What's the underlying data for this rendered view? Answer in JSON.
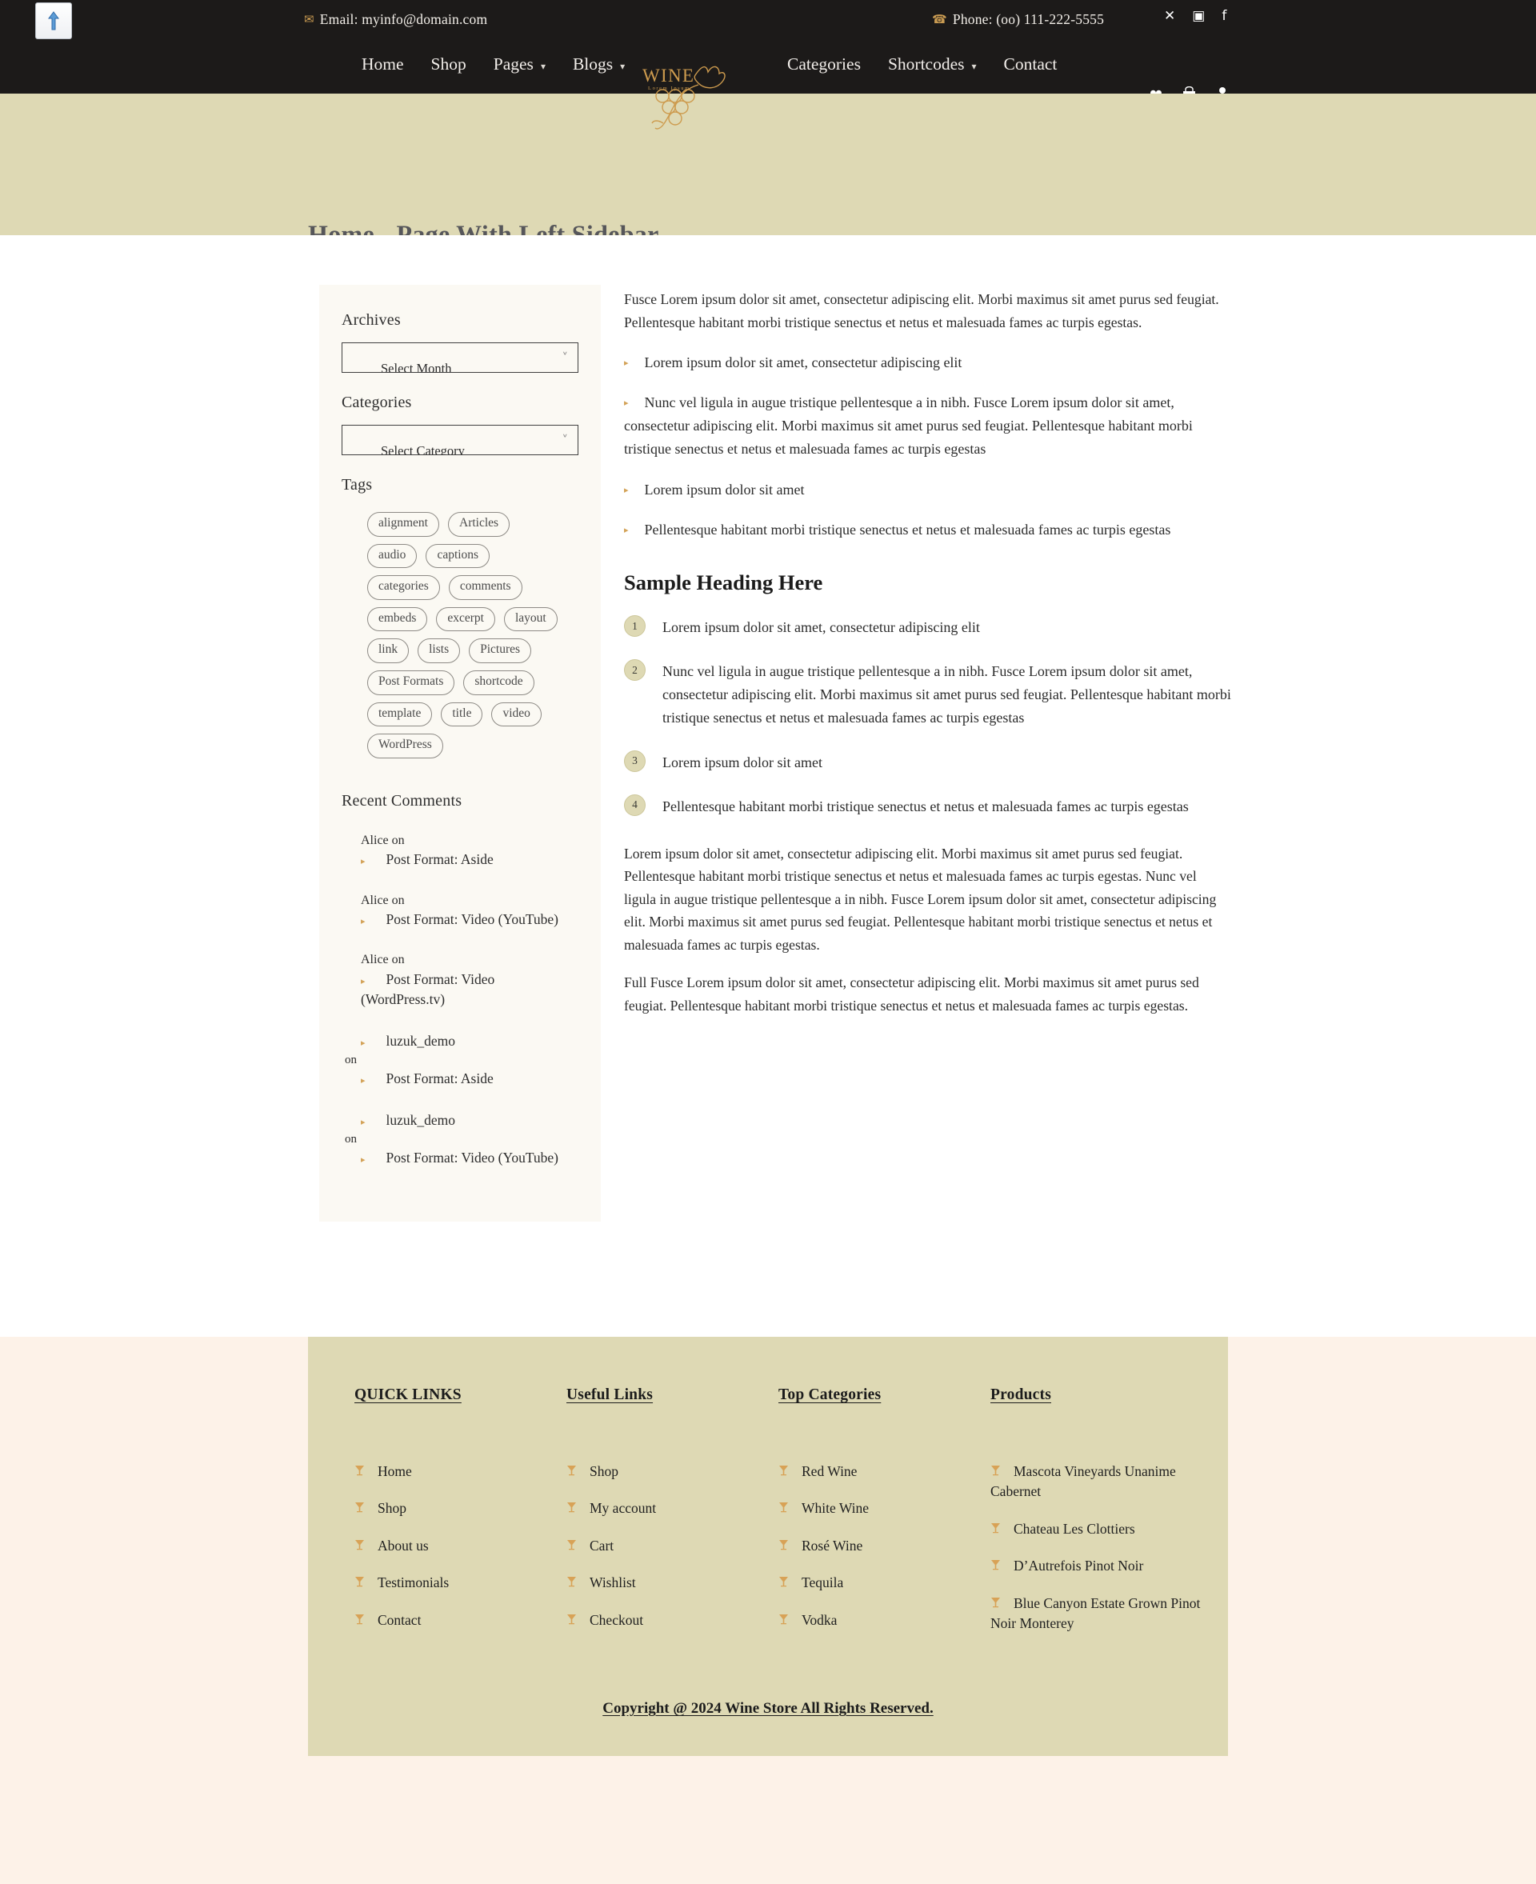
{
  "header": {
    "scroll_top_icon": "scroll-to-top-icon",
    "email_label": "Email: myinfo@domain.com",
    "email_icon": "envelope-icon",
    "phone_label": "Phone: (oo) 111-222-5555",
    "phone_icon": "phone-icon",
    "socials": [
      {
        "name": "twitter-x-icon",
        "glyph": "✕"
      },
      {
        "name": "instagram-icon",
        "glyph": "▣"
      },
      {
        "name": "facebook-icon",
        "glyph": "f"
      }
    ],
    "logo": {
      "word": "WINE",
      "subtitle": "Lorem Ipsum"
    },
    "nav_left": [
      {
        "label": "Home",
        "has_caret": false
      },
      {
        "label": "Shop",
        "has_caret": false
      },
      {
        "label": "Pages",
        "has_caret": true
      },
      {
        "label": "Blogs",
        "has_caret": true
      }
    ],
    "nav_right": [
      {
        "label": "Categories",
        "has_caret": false
      },
      {
        "label": "Shortcodes",
        "has_caret": true
      },
      {
        "label": "Contact",
        "has_caret": false
      }
    ],
    "actions": [
      {
        "name": "wishlist-heart-icon",
        "glyph": "♥"
      },
      {
        "name": "cart-basket-icon",
        "glyph": "⛉"
      },
      {
        "name": "account-user-icon",
        "glyph": "♟"
      }
    ]
  },
  "banner": {
    "title": "Home - Page With Left Sidebar",
    "bg_color": "#ded9b4"
  },
  "sidebar": {
    "archives": {
      "title": "Archives",
      "select_value": "Select Month",
      "caret_icon": "chevron-down-icon"
    },
    "categories": {
      "title": "Categories",
      "select_value": "Select Category",
      "caret_icon": "chevron-down-icon"
    },
    "tags": {
      "title": "Tags",
      "items": [
        "alignment",
        "Articles",
        "audio",
        "captions",
        "categories",
        "comments",
        "embeds",
        "excerpt",
        "layout",
        "link",
        "lists",
        "Pictures",
        "Post Formats",
        "shortcode",
        "template",
        "title",
        "video",
        "WordPress"
      ]
    },
    "recent_comments": {
      "title": "Recent Comments",
      "items": [
        {
          "author": "Alice",
          "on": "on",
          "post": "Post Format: Aside",
          "author_is_link": false
        },
        {
          "author": "Alice",
          "on": "on",
          "post": "Post Format: Video (YouTube)",
          "author_is_link": false
        },
        {
          "author": "Alice",
          "on": "on",
          "post": "Post Format: Video (WordPress.tv)",
          "author_is_link": false
        },
        {
          "author": "luzuk_demo",
          "on": "on",
          "post": "Post Format: Aside",
          "author_is_link": true
        },
        {
          "author": "luzuk_demo",
          "on": "on",
          "post": "Post Format: Video (YouTube)",
          "author_is_link": true
        }
      ]
    }
  },
  "main": {
    "intro": "Fusce Lorem ipsum dolor sit amet, consectetur adipiscing elit. Morbi maximus sit amet purus sed feugiat. Pellentesque habitant morbi tristique senectus et netus et malesuada fames ac turpis egestas.",
    "bullets": [
      "Lorem ipsum dolor sit amet, consectetur adipiscing elit",
      "Nunc vel ligula in augue tristique pellentesque a in nibh. Fusce Lorem ipsum dolor sit amet, consectetur adipiscing elit. Morbi maximus sit amet purus sed feugiat. Pellentesque habitant morbi tristique senectus et netus et malesuada fames ac turpis egestas",
      "Lorem ipsum dolor sit amet",
      "Pellentesque habitant morbi tristique senectus et netus et malesuada fames ac turpis egestas"
    ],
    "heading": "Sample Heading Here",
    "numbered": [
      {
        "num": "1",
        "text": "Lorem ipsum dolor sit amet, consectetur adipiscing elit"
      },
      {
        "num": "2",
        "text": "Nunc vel ligula in augue tristique pellentesque a in nibh. Fusce Lorem ipsum dolor sit amet, consectetur adipiscing elit. Morbi maximus sit amet purus sed feugiat. Pellentesque habitant morbi tristique senectus et netus et malesuada fames ac turpis egestas"
      },
      {
        "num": "3",
        "text": "Lorem ipsum dolor sit amet"
      },
      {
        "num": "4",
        "text": "Pellentesque habitant morbi tristique senectus et netus et malesuada fames ac turpis egestas"
      }
    ],
    "para_2": "Lorem ipsum dolor sit amet, consectetur adipiscing elit. Morbi maximus sit amet purus sed feugiat. Pellentesque habitant morbi tristique senectus et netus et malesuada fames ac turpis egestas. Nunc vel ligula in augue tristique pellentesque a in nibh. Fusce Lorem ipsum dolor sit amet, consectetur adipiscing elit. Morbi maximus sit amet purus sed feugiat. Pellentesque habitant morbi tristique senectus et netus et malesuada fames ac turpis egestas.",
    "para_3": "Full Fusce Lorem ipsum dolor sit amet, consectetur adipiscing elit. Morbi maximus sit amet purus sed feugiat. Pellentesque habitant morbi tristique senectus et netus et malesuada fames ac turpis egestas."
  },
  "footer": {
    "bg_color": "#ded9b4",
    "accent_color": "#d8a256",
    "columns": [
      {
        "title": "QUICK LINKS",
        "items": [
          "Home",
          "Shop",
          "About us",
          "Testimonials",
          "Contact"
        ]
      },
      {
        "title": "Useful Links",
        "items": [
          "Shop",
          "My account",
          "Cart",
          "Wishlist",
          "Checkout"
        ]
      },
      {
        "title": "Top Categories",
        "items": [
          "Red Wine",
          "White Wine",
          "Rosé Wine",
          "Tequila",
          "Vodka"
        ]
      },
      {
        "title": "Products",
        "items": [
          "Mascota Vineyards Unanime Cabernet",
          "Chateau Les Clottiers",
          "D’Autrefois Pinot Noir",
          "Blue Canyon Estate Grown Pinot Noir Monterey"
        ]
      }
    ],
    "copyright": "Copyright @ 2024 Wine Store All Rights Reserved."
  }
}
